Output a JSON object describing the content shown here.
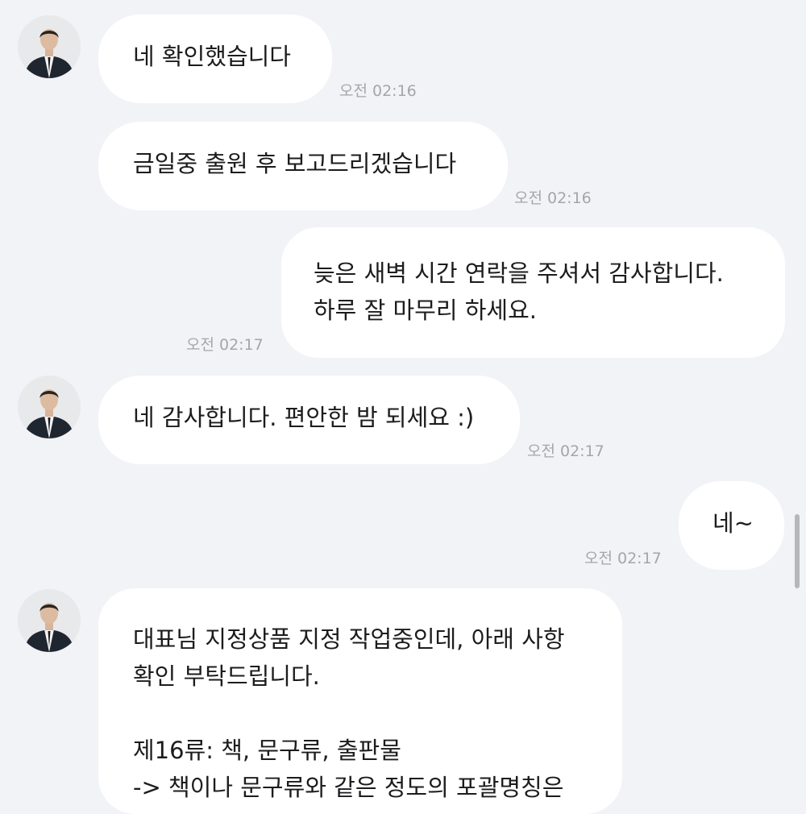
{
  "messages": [
    {
      "sender": "other",
      "lines": [
        "네 확인했습니다"
      ],
      "time": "오전 02:16"
    },
    {
      "sender": "other",
      "lines": [
        "금일중 출원 후 보고드리겠습니다"
      ],
      "time": "오전 02:16"
    },
    {
      "sender": "me",
      "lines": [
        "늦은 새벽 시간 연락을 주셔서 감사합니다.",
        "하루 잘 마무리 하세요."
      ],
      "time": "오전 02:17"
    },
    {
      "sender": "other",
      "lines": [
        "네 감사합니다. 편안한 밤 되세요 :)"
      ],
      "time": "오전 02:17"
    },
    {
      "sender": "me",
      "lines": [
        "네~"
      ],
      "time": "오전 02:17"
    },
    {
      "sender": "other",
      "lines": [
        "대표님 지정상품 지정 작업중인데, 아래 사항",
        "확인 부탁드립니다.",
        "",
        "제16류: 책, 문구류, 출판물",
        "-> 책이나 문구류와 같은 정도의 포괄명칭은"
      ]
    }
  ],
  "colors": {
    "background": "#f2f3f7",
    "bubble": "#ffffff",
    "text": "#1c1c1e",
    "timestamp": "#a3a6ad"
  },
  "icons": {
    "avatar": "profile-photo-man-in-suit",
    "scrollbar": "scroll-thumb"
  }
}
